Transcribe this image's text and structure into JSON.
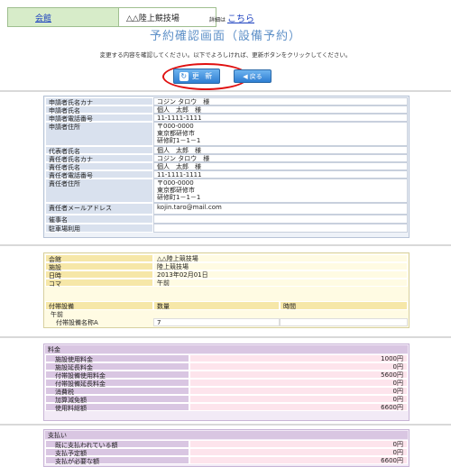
{
  "header": {
    "venue_link": "会館",
    "facility": "△△陸上競技場",
    "detail_label": "詳細は",
    "detail_link": "こちら"
  },
  "page_title": "予約確認画面（設備予約）",
  "notice": "変更する内容を確認してください。以下でよろしければ、更新ボタンをクリックしてください。",
  "buttons": {
    "update": "更 新",
    "back": "戻る",
    "update_icon": "refresh-icon",
    "back_icon": "back-arrow-icon"
  },
  "applicant": [
    {
      "label": "申請者氏名カナ",
      "value": "コジン タロウ　様"
    },
    {
      "label": "申請者氏名",
      "value": "個人　太郎　様"
    },
    {
      "label": "申請者電話番号",
      "value": "11-1111-1111"
    },
    {
      "label": "申請者住所",
      "value": "〒000-0000\n東京都研修市\n研修町1－1－1"
    },
    {
      "label": "代表者氏名",
      "value": "個人　太郎　様"
    },
    {
      "label": "責任者氏名カナ",
      "value": "コジン タロウ　様"
    },
    {
      "label": "責任者氏名",
      "value": "個人　太郎　様"
    },
    {
      "label": "責任者電話番号",
      "value": "11-1111-1111"
    },
    {
      "label": "責任者住所",
      "value": "〒000-0000\n東京都研修市\n研修町1－1－1"
    },
    {
      "label": "責任者メールアドレス",
      "value": "kojin.taro@mail.com"
    },
    {
      "label": "催事名",
      "value": ""
    },
    {
      "label": "駐車場利用",
      "value": ""
    }
  ],
  "reservation": [
    {
      "label": "会館",
      "value": "△△陸上競技場"
    },
    {
      "label": "施設",
      "value": "陸上競技場"
    },
    {
      "label": "日時",
      "value": "2013年02月01日"
    },
    {
      "label": "コマ",
      "value": "午前"
    }
  ],
  "equipment": {
    "headers": [
      "付帯設備",
      "数量",
      "時間"
    ],
    "period": "午前",
    "items": [
      {
        "name": "付帯設備名称A",
        "qty": "7",
        "time": ""
      }
    ]
  },
  "fee": {
    "title": "料金",
    "rows": [
      {
        "label": "施設使用料金",
        "value": "1000円"
      },
      {
        "label": "施設延長料金",
        "value": "0円"
      },
      {
        "label": "付帯設備使用料金",
        "value": "5600円"
      },
      {
        "label": "付帯設備延長料金",
        "value": "0円"
      },
      {
        "label": "消費税",
        "value": "0円"
      },
      {
        "label": "加算減免額",
        "value": "0円"
      },
      {
        "label": "使用料総額",
        "value": "6600円"
      }
    ]
  },
  "payment": {
    "title": "支払い",
    "rows": [
      {
        "label": "既に支払われている額",
        "value": "0円"
      },
      {
        "label": "支払予定額",
        "value": "0円"
      },
      {
        "label": "支払が必要な額",
        "value": "6600円"
      }
    ]
  }
}
